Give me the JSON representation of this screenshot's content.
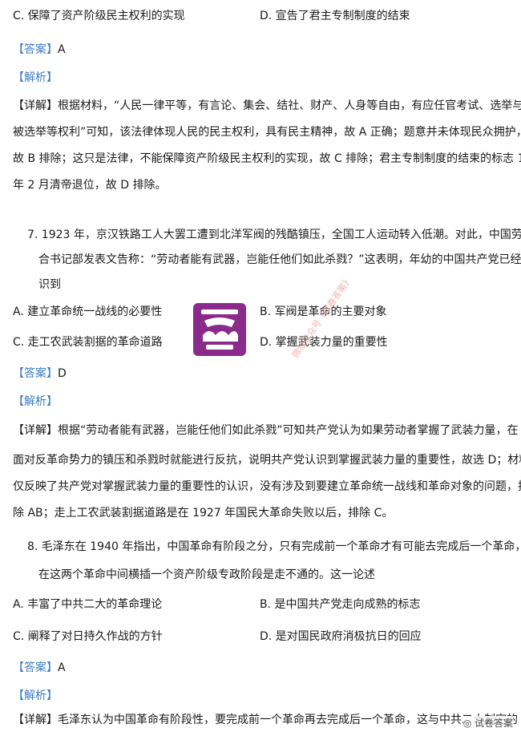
{
  "q6": {
    "option_c": "C. 保障了资产阶级民主权利的实现",
    "option_d": "D. 宣告了君主专制制度的结束",
    "answer_tag": "【答案】",
    "answer_value": "A",
    "analysis_tag": "【解析】",
    "detail_tag": "【详解】",
    "detail_lines": [
      "根据材料，“人民一律平等，有言论、集会、结社、财产、人身等自由，有应任官考试、选举与",
      "被选举等权利”可知，该法律体现人民的民主权利，具有民主精神，故 A 正确；题意并未体现民众拥护，",
      "故 B 排除；这只是法律，不能保障资产阶级民主权利的实现，故 C 排除；君主专制制度的结束的标志 1912",
      "年 2 月清帝退位，故 D 排除。"
    ]
  },
  "q7": {
    "stem_lines": [
      "7. 1923 年，京汉铁路工人大罢工遭到北洋军阀的残酷镇压，全国工人运动转入低潮。对此，中国劳动组",
      "合书记部发表文告称：“劳动者能有武器，岂能任他们如此杀戮？”这表明，年幼的中国共产党已经认",
      "识到"
    ],
    "option_a": "A. 建立革命统一战线的必要性",
    "option_b": "B. 军阀是革命的主要对象",
    "option_c": "C. 走工农武装割据的革命道路",
    "option_d": "D. 掌握武装力量的重要性",
    "answer_tag": "【答案】",
    "answer_value": "D",
    "analysis_tag": "【解析】",
    "detail_tag": "【详解】",
    "detail_lines": [
      "根据“劳动者能有武器，岂能任他们如此杀戮”可知共产党认为如果劳动者掌握了武装力量，在",
      "面对反革命势力的镇压和杀戮时就能进行反抗，说明共产党认识到掌握武装力量的重要性，故选 D；材料",
      "仅反映了共产党对掌握武装力量的重要性的认识，没有涉及到要建立革命统一战线和革命对象的问题，排",
      "除 AB；走上工农武装割据道路是在 1927 年国民大革命失败以后，排除 C。"
    ]
  },
  "q8": {
    "stem_lines": [
      "8. 毛泽东在 1940 年指出，中国革命有阶段之分，只有完成前一个革命才有可能去完成后一个革命，想",
      "在这两个革命中间横插一个资产阶级专政阶段是走不通的。这一论述"
    ],
    "option_a": "A. 丰富了中共二大的革命理论",
    "option_b": "B. 是中国共产党走向成熟的标志",
    "option_c": "C. 阐释了对日持久作战的方针",
    "option_d": "D. 是对国民政府消极抗日的回应",
    "answer_tag": "【答案】",
    "answer_value": "A",
    "analysis_tag": "【解析】",
    "detail_tag": "【详解】",
    "detail_line": "毛泽东认为中国革命有阶段性，要完成前一个革命再去完成后一个革命，这与中共二大制定的"
  },
  "watermark_text": "微信公众号《试卷答案》",
  "corner_text": "试卷答案",
  "colors": {
    "tag": "#3a7cc0",
    "logo": "#8a2b8c",
    "watermark": "#f1a9a9"
  }
}
